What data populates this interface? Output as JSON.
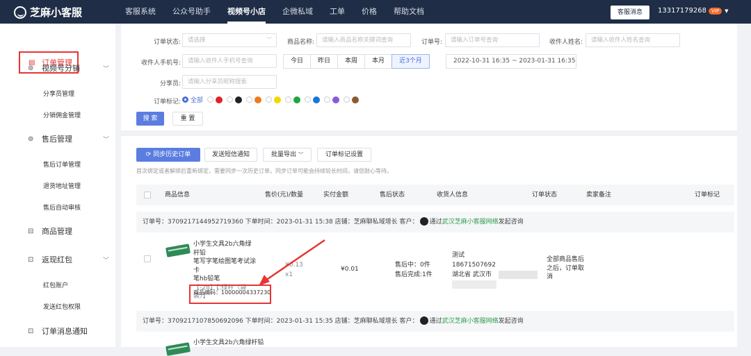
{
  "topbar": {
    "logo": "芝麻小客服",
    "nav": [
      "客服系统",
      "公众号助手",
      "视频号小店",
      "企微私域",
      "工单",
      "价格",
      "帮助文档"
    ],
    "active_nav": 2,
    "msg_button": "客服消息",
    "phone": "13317179268",
    "vip_badge": "VIP"
  },
  "sidebar": {
    "active": {
      "icon": "▤",
      "label": "订单管理"
    },
    "groups": [
      {
        "icon": "⊚",
        "label": "视频号分销",
        "children": [
          "分享员管理",
          "分销佣金管理"
        ]
      },
      {
        "icon": "⊚",
        "label": "售后管理",
        "children": [
          "售后订单管理",
          "退货地址管理",
          "售后自动审核"
        ]
      },
      {
        "icon": "⊟",
        "label": "商品管理",
        "children": []
      },
      {
        "icon": "⊡",
        "label": "返现红包",
        "children": [
          "红包账户",
          "发送红包权限"
        ]
      },
      {
        "icon": "⊡",
        "label": "订单消息通知",
        "children": []
      }
    ]
  },
  "filter": {
    "order_status_label": "订单状态:",
    "order_status_placeholder": "请选择",
    "product_name_label": "商品名称:",
    "product_name_placeholder": "请输入商品名称关键词查询",
    "order_no_label": "订单号:",
    "order_no_placeholder": "请输入订单号查询",
    "receiver_name_label": "收件人姓名:",
    "receiver_name_placeholder": "请输入收件人姓名查询",
    "receiver_phone_label": "收件人手机号:",
    "receiver_phone_placeholder": "请输入收件人手机号查询",
    "periods": [
      "今日",
      "昨日",
      "本周",
      "本月",
      "近3个月"
    ],
    "active_period": 4,
    "date_range": "2022-10-31 16:35 ~ 2023-01-31 16:35",
    "sharer_label": "分享员:",
    "sharer_placeholder": "请输入分享员昵称搜索",
    "mark_label": "订单标记:",
    "mark_all": "全部",
    "mark_colors": [
      "#e0212a",
      "#222222",
      "#f07a1a",
      "#f5d700",
      "#22a63a",
      "#1677d8",
      "#8a5ad8",
      "#8a5a32"
    ],
    "search_button": "搜 索",
    "reset_button": "重 置"
  },
  "toolbar": {
    "sync_button": "同步历史订单",
    "sync_icon": "refresh-icon",
    "sms_button": "发送短信通知",
    "export_button": "批量导出",
    "mark_setting_button": "订单标记设置",
    "hint": "首次绑定或者解绑后重新绑定，需要同步一次历史订单。同步订单可能会持续较长时间，请您耐心等待。"
  },
  "table": {
    "headers": [
      "商品信息",
      "售价(元)/数量",
      "实付金额",
      "售后状态",
      "收货人信息",
      "订单状态",
      "卖家备注",
      "订单标记"
    ],
    "orders": [
      {
        "header": {
          "order_no": "订单号：3709217144952719360",
          "time": "下单时间：2023-01-31 15:38",
          "shop": "店铺：芝麻聊私域增长",
          "customer_label": "客户：",
          "via": "通过",
          "via_link": "武汉芝麻小客服网络",
          "consult": "发起咨询"
        },
        "product_lines": [
          "小学生文具2b六角绿杆铅",
          "笔写字笔绘图笔考试涂卡",
          "笔hb铅笔"
        ],
        "spec": "【-28】【:绿杆（袋",
        "spec2": "装）】",
        "product_code": "商品编码：10000004337230",
        "price": "¥0.13",
        "qty": "x1",
        "paid": "¥0.01",
        "after_sale": [
          "售后中：0件",
          "售后完成:1件"
        ],
        "receiver": [
          "测试",
          "18671507692",
          "湖北省 武汉市"
        ],
        "status": [
          "全部商品售后",
          "之后，订单取",
          "消"
        ]
      },
      {
        "header": {
          "order_no": "订单号：3709217107850692096",
          "time": "下单时间：2023-01-31 15:35",
          "shop": "店铺：芝麻聊私域增长",
          "customer_label": "客户：",
          "via": "通过",
          "via_link": "武汉芝麻小客服网络",
          "consult": "发起咨询"
        },
        "product_lines": [
          "小学生文具2b六角绿杆铅"
        ]
      }
    ]
  },
  "colors": {
    "topbar": "#1f2d46",
    "primary": "#5b7de0",
    "highlight": "#e63434"
  }
}
